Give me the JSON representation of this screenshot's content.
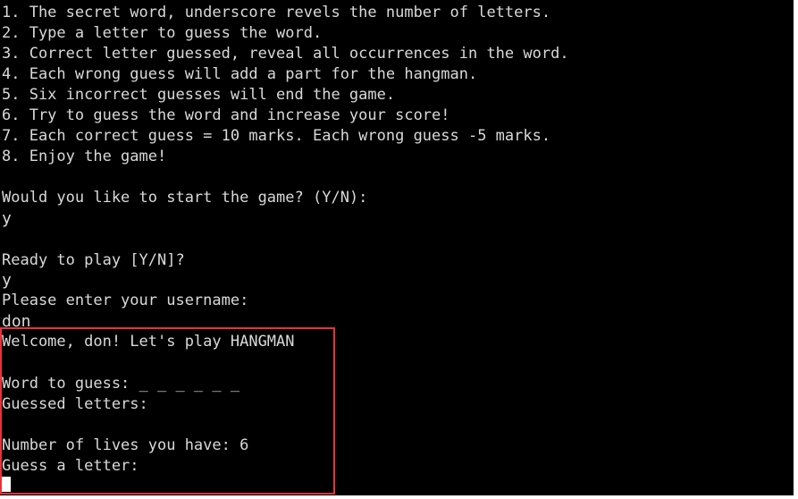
{
  "instructions": [
    "1. The secret word, underscore revels the number of letters.",
    "2. Type a letter to guess the word.",
    "3. Correct letter guessed, reveal all occurrences in the word.",
    "4. Each wrong guess will add a part for the hangman.",
    "5. Six incorrect guesses will end the game.",
    "6. Try to guess the word and increase your score!",
    "7. Each correct guess = 10 marks. Each wrong guess -5 marks.",
    "8. Enjoy the game!"
  ],
  "start_prompt": "Would you like to start the game? (Y/N):",
  "start_answer": "y",
  "ready_prompt": "Ready to play [Y/N]?",
  "ready_answer": "y",
  "username_prompt": "Please enter your username:",
  "username_answer": "don",
  "game": {
    "welcome": "Welcome, don! Let's play HANGMAN",
    "word_to_guess": "Word to guess: _ _ _ _ _ _",
    "guessed_letters": "Guessed letters:",
    "lives": "Number of lives you have: 6",
    "guess_prompt": "Guess a letter:"
  },
  "colors": {
    "background": "#000000",
    "text": "#d9d9d9",
    "highlight": "#e8323a"
  }
}
